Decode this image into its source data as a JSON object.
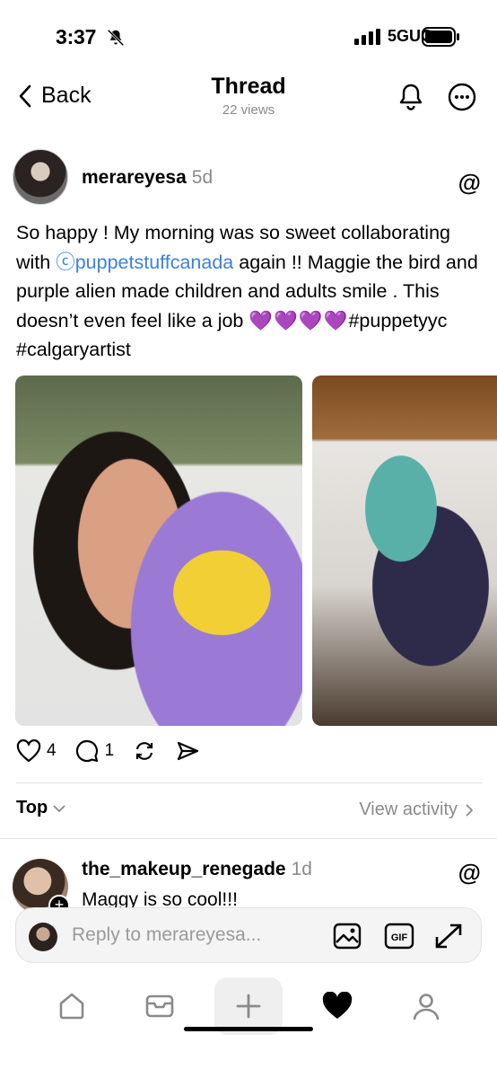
{
  "status_bar": {
    "time": "3:37",
    "network": "5GUC"
  },
  "nav": {
    "back_label": "Back",
    "title": "Thread",
    "views": "22 views"
  },
  "post": {
    "username": "merareyesa",
    "age": "5d",
    "text_1": "So happy ! My morning was so sweet collaborating with ",
    "mention": "ⓒpuppetstuffcanada",
    "text_2": "  again !! Maggie the bird and purple alien made children and adults smile . This doesn’t even feel like a job ",
    "hearts": "💜💜💜💜",
    "hashtags": "#puppetyyc #calgaryartist",
    "likes": "4",
    "comments": "1"
  },
  "replies_header": {
    "sort_label": "Top",
    "view_activity": "View activity"
  },
  "reply": {
    "username": "the_makeup_renegade",
    "age": "1d",
    "text": "Maggy is so cool!!!"
  },
  "composer": {
    "placeholder": "Reply to merareyesa..."
  },
  "colors": {
    "link": "#3b82d9",
    "secondary_text": "#8a8a8a",
    "heart": "#9b3fe0"
  }
}
